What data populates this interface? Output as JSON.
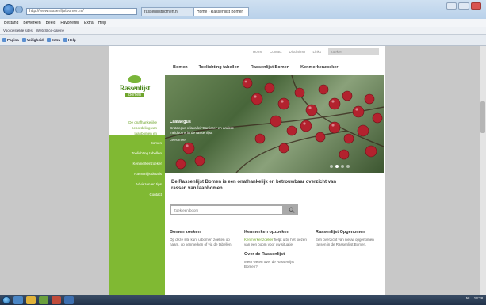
{
  "browser": {
    "address": "http://www.rassenlijstbomen.nl/",
    "tabs": [
      "rassenlijstbomen.nl",
      "Home - Rassenlijst Bomen"
    ],
    "menu": [
      "Bestand",
      "Bewerken",
      "Beeld",
      "Favorieten",
      "Extra",
      "Help"
    ],
    "favorites": [
      "Voorgestelde sites",
      "Web Slice-galerie"
    ],
    "commands": [
      "Pagina",
      "Veiligheid",
      "Extra",
      "Help"
    ]
  },
  "site": {
    "topnav": [
      "Home",
      "Contact",
      "Disclaimer",
      "Links"
    ],
    "search_placeholder": "Zoeken",
    "logo": {
      "name": "Rassenlijst",
      "sub": "Bomen"
    },
    "tagline": [
      "De onafhankelijke",
      "beoordeling van",
      "laanbomen en",
      "heesters"
    ],
    "mainnav": [
      "Bomen",
      "Toelichting tabellen",
      "Rassenlijst Bomen",
      "Kenmerkenzoeker"
    ],
    "sidebar": [
      "Bomen",
      "Toelichting tabellen",
      "Kenmerkenzoeker",
      "Rassenlijstdetails",
      "Adviezen en tips",
      "Contact"
    ],
    "hero": {
      "title": "Crataegus",
      "text": "Crataegus x lavallei 'Carrierei' en andere meidoorns in de rassenlijst.",
      "more": "Lees meer"
    },
    "intro": "De Rassenlijst Bomen is een onafhankelijk en betrouwbaar overzicht van rassen van laanbomen.",
    "search_input_placeholder": "Zoek een boom",
    "columns": [
      {
        "title": "Bomen zoeken",
        "text": "Op deze site kunt u bomen zoeken op naam, op kenmerken of via de tabellen.",
        "sub": "",
        "subtext": ""
      },
      {
        "title": "Kenmerken opzoeken",
        "link": "Kenmerkenzoeker",
        "text": "helpt u bij het kiezen van een boom voor uw situatie.",
        "sub": "Over de Rassenlijst",
        "subtext": "Meer weten over de Rassenlijst Bomen?"
      },
      {
        "title": "Rassenlijst Opgenomen",
        "text": "Een overzicht van nieuw opgenomen rassen in de Rassenlijst Bomen."
      }
    ]
  },
  "taskbar": {
    "clock": "13:28",
    "lang": "NL"
  },
  "colors": {
    "sidebar_green": "#80b933",
    "logo_green": "#4e8a1f",
    "berry_red": "#b3222e"
  }
}
